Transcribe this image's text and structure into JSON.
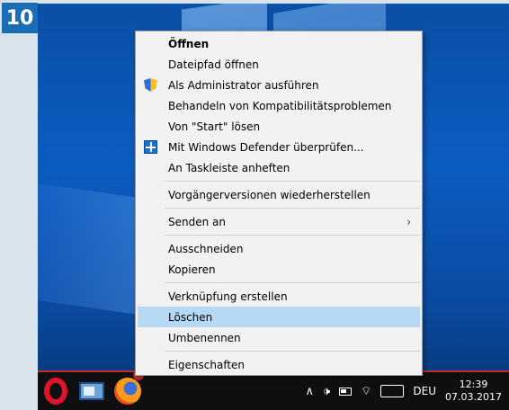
{
  "step_badge": "10",
  "context_menu": {
    "items": [
      {
        "label": "Öffnen",
        "bold": true
      },
      {
        "label": "Dateipfad öffnen"
      },
      {
        "label": "Als Administrator ausführen",
        "icon": "uac-shield-icon"
      },
      {
        "label": "Behandeln von Kompatibilitätsproblemen"
      },
      {
        "label": "Von \"Start\" lösen"
      },
      {
        "label": "Mit Windows Defender überprüfen...",
        "icon": "windows-defender-icon"
      },
      {
        "label": "An Taskleiste anheften"
      },
      {
        "label": "Vorgängerversionen wiederherstellen"
      },
      {
        "label": "Senden an",
        "submenu": true
      },
      {
        "label": "Ausschneiden"
      },
      {
        "label": "Kopieren"
      },
      {
        "label": "Verknüpfung erstellen"
      },
      {
        "label": "Löschen",
        "highlighted": true
      },
      {
        "label": "Umbenennen"
      },
      {
        "label": "Eigenschaften"
      }
    ],
    "submenu_arrow": "›"
  },
  "taskbar": {
    "apps": [
      "opera-icon",
      "task-view-icon",
      "firefox-icon"
    ],
    "tray": {
      "chevron": "∧",
      "volume": "🕩",
      "language": "DEU",
      "time": "12:39",
      "date": "07.03.2017"
    }
  },
  "colors": {
    "accent": "#1b6db5",
    "highlight": "#b7d8f2",
    "taskbar_line": "#c42b2b"
  }
}
